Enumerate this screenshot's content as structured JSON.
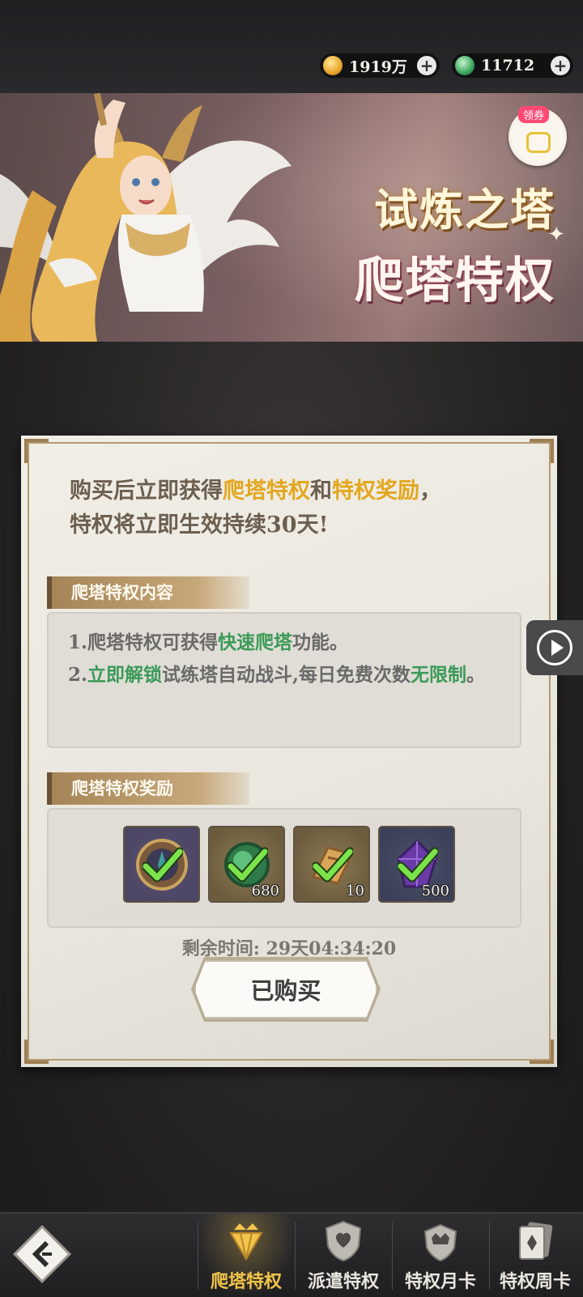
{
  "currency": {
    "gold": {
      "icon": "gold-coin-icon",
      "value": "1919万"
    },
    "jade": {
      "icon": "jade-icon",
      "value": "11712"
    }
  },
  "banner": {
    "title_line1": "试炼之塔",
    "title_line2": "爬塔特权",
    "coupon_label": "领券"
  },
  "panel": {
    "intro": {
      "p1": "购买后立即获得",
      "p2": "爬塔特权",
      "p3": "和",
      "p4": "特权奖励",
      "p5": "，",
      "p6": "特权将立即生效持续30天!"
    },
    "content_title": "爬塔特权内容",
    "content": {
      "l1a": "1.爬塔特权可获得",
      "l1b": "快速爬塔",
      "l1c": "功能。",
      "l2a": "2.",
      "l2b": "立即解锁",
      "l2c": "试练塔自动战斗,每日免费次数",
      "l2d": "无限制",
      "l2e": "。"
    },
    "reward_title": "爬塔特权奖励",
    "rewards": [
      {
        "icon": "emblem-icon",
        "qty": "",
        "claimed": true
      },
      {
        "icon": "jade-orb-icon",
        "qty": "680",
        "claimed": true
      },
      {
        "icon": "scroll-icon",
        "qty": "10",
        "claimed": true
      },
      {
        "icon": "purple-crystal-icon",
        "qty": "500",
        "claimed": true
      }
    ],
    "timer": "剩余时间: 29天04:34:20",
    "button": "已购买"
  },
  "nav": {
    "tabs": [
      {
        "label": "爬塔特权",
        "icon": "crown-diamond-icon",
        "active": true
      },
      {
        "label": "派遣特权",
        "icon": "heart-shield-icon",
        "active": false
      },
      {
        "label": "特权月卡",
        "icon": "crown-shield-icon",
        "active": false
      },
      {
        "label": "特权周卡",
        "icon": "card-icon",
        "active": false
      }
    ]
  },
  "colors": {
    "gold_highlight": "#e3a71f",
    "green_highlight": "#3a9a58",
    "active_tab": "#f2c44a"
  }
}
